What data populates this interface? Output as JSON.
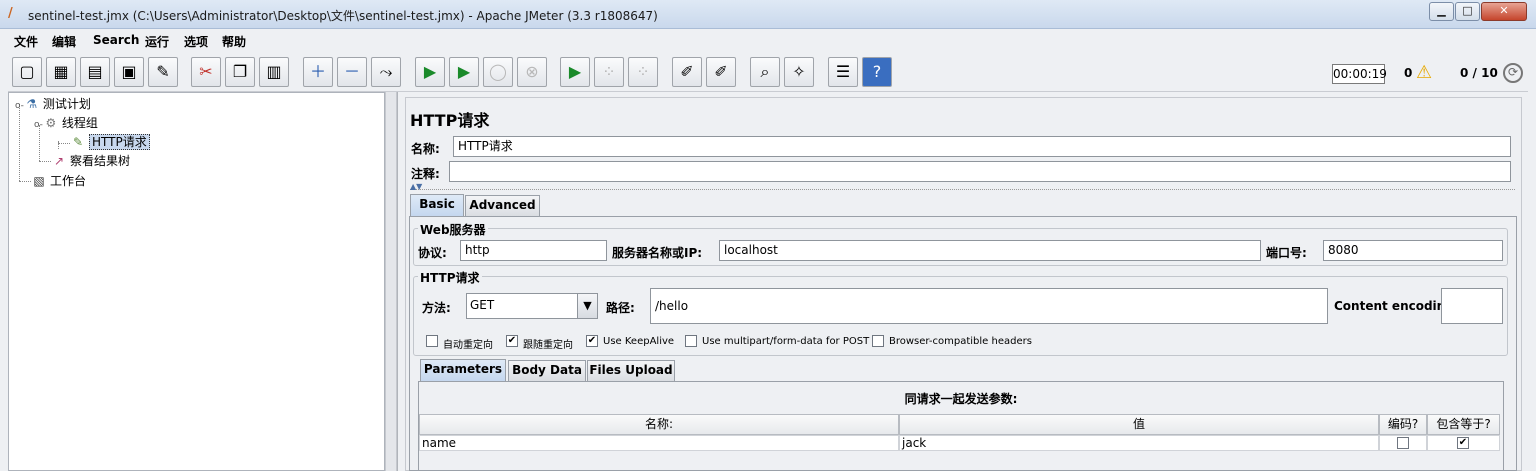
{
  "window": {
    "title": "sentinel-test.jmx (C:\\Users\\Administrator\\Desktop\\文件\\sentinel-test.jmx) - Apache JMeter (3.3 r1808647)",
    "minimize": "▁",
    "maximize": "□",
    "close": "✕"
  },
  "menu": [
    "文件",
    "编辑",
    "Search",
    "运行",
    "选项",
    "帮助"
  ],
  "toolbar": {
    "buttons": [
      {
        "name": "new-icon",
        "glyph": "▢",
        "enabled": true
      },
      {
        "name": "templates-icon",
        "glyph": "▦",
        "enabled": true
      },
      {
        "name": "open-icon",
        "glyph": "▤",
        "enabled": true
      },
      {
        "name": "save-icon",
        "glyph": "▣",
        "enabled": true
      },
      {
        "name": "save-as-icon",
        "glyph": "✎",
        "enabled": true
      },
      {
        "name": "cut-icon",
        "glyph": "✂",
        "enabled": true
      },
      {
        "name": "copy-icon",
        "glyph": "❐",
        "enabled": true
      },
      {
        "name": "paste-icon",
        "glyph": "▥",
        "enabled": true
      },
      {
        "name": "expand-icon",
        "glyph": "＋",
        "enabled": true
      },
      {
        "name": "collapse-icon",
        "glyph": "－",
        "enabled": true
      },
      {
        "name": "toggle-icon",
        "glyph": "⤳",
        "enabled": true
      },
      {
        "name": "start-icon",
        "glyph": "▶",
        "enabled": true
      },
      {
        "name": "start-no-pause-icon",
        "glyph": "▶",
        "enabled": true
      },
      {
        "name": "stop-icon",
        "glyph": "◯",
        "enabled": false
      },
      {
        "name": "shutdown-icon",
        "glyph": "⊗",
        "enabled": false
      },
      {
        "name": "remote-start-icon",
        "glyph": "▶",
        "enabled": true
      },
      {
        "name": "remote-stop-icon",
        "glyph": "⁘",
        "enabled": false
      },
      {
        "name": "remote-shutdown-icon",
        "glyph": "⁘",
        "enabled": false
      },
      {
        "name": "clear-icon",
        "glyph": "✐",
        "enabled": true
      },
      {
        "name": "clear-all-icon",
        "glyph": "✐",
        "enabled": true
      },
      {
        "name": "search-icon",
        "glyph": "⌕",
        "enabled": true
      },
      {
        "name": "reset-search-icon",
        "glyph": "✧",
        "enabled": true
      },
      {
        "name": "function-helper-icon",
        "glyph": "☰",
        "enabled": true
      },
      {
        "name": "help-icon",
        "glyph": "?",
        "enabled": true
      }
    ],
    "timer": "00:00:19",
    "error_count": "0",
    "warning_icon": "⚠",
    "threads": "0 / 10",
    "status_icon": "⟳"
  },
  "tree": {
    "items": [
      {
        "label": "测试计划",
        "icon": "flask-icon",
        "glyph": "⚗"
      },
      {
        "label": "线程组",
        "icon": "gear-icon",
        "glyph": "⚙"
      },
      {
        "label": "HTTP请求",
        "icon": "pipette-icon",
        "glyph": "✎"
      },
      {
        "label": "察看结果树",
        "icon": "chart-icon",
        "glyph": "↗"
      },
      {
        "label": "工作台",
        "icon": "workbench-icon",
        "glyph": "▧"
      }
    ]
  },
  "sampler": {
    "title": "HTTP请求",
    "name_label": "名称:",
    "name_value": "HTTP请求",
    "comment_label": "注释:",
    "comment_value": "",
    "tabs": [
      "Basic",
      "Advanced"
    ],
    "web_server": {
      "group_title": "Web服务器",
      "protocol_label": "协议:",
      "protocol_value": "http",
      "server_label": "服务器名称或IP:",
      "server_value": "localhost",
      "port_label": "端口号:",
      "port_value": "8080"
    },
    "http_request": {
      "group_title": "HTTP请求",
      "method_label": "方法:",
      "method_value": "GET",
      "path_label": "路径:",
      "path_value": "/hello",
      "encoding_label": "Content encoding:",
      "encoding_value": ""
    },
    "checkboxes": [
      {
        "label": "自动重定向",
        "checked": false
      },
      {
        "label": "跟随重定向",
        "checked": true
      },
      {
        "label": "Use KeepAlive",
        "checked": true
      },
      {
        "label": "Use multipart/form-data for POST",
        "checked": false
      },
      {
        "label": "Browser-compatible headers",
        "checked": false
      }
    ],
    "sub_tabs": [
      "Parameters",
      "Body Data",
      "Files Upload"
    ],
    "params": {
      "caption": "同请求一起发送参数:",
      "headers": [
        "名称:",
        "值",
        "编码?",
        "包含等于?"
      ],
      "rows": [
        {
          "name": "name",
          "value": "jack",
          "encode": false,
          "include_equals": true
        }
      ]
    }
  }
}
